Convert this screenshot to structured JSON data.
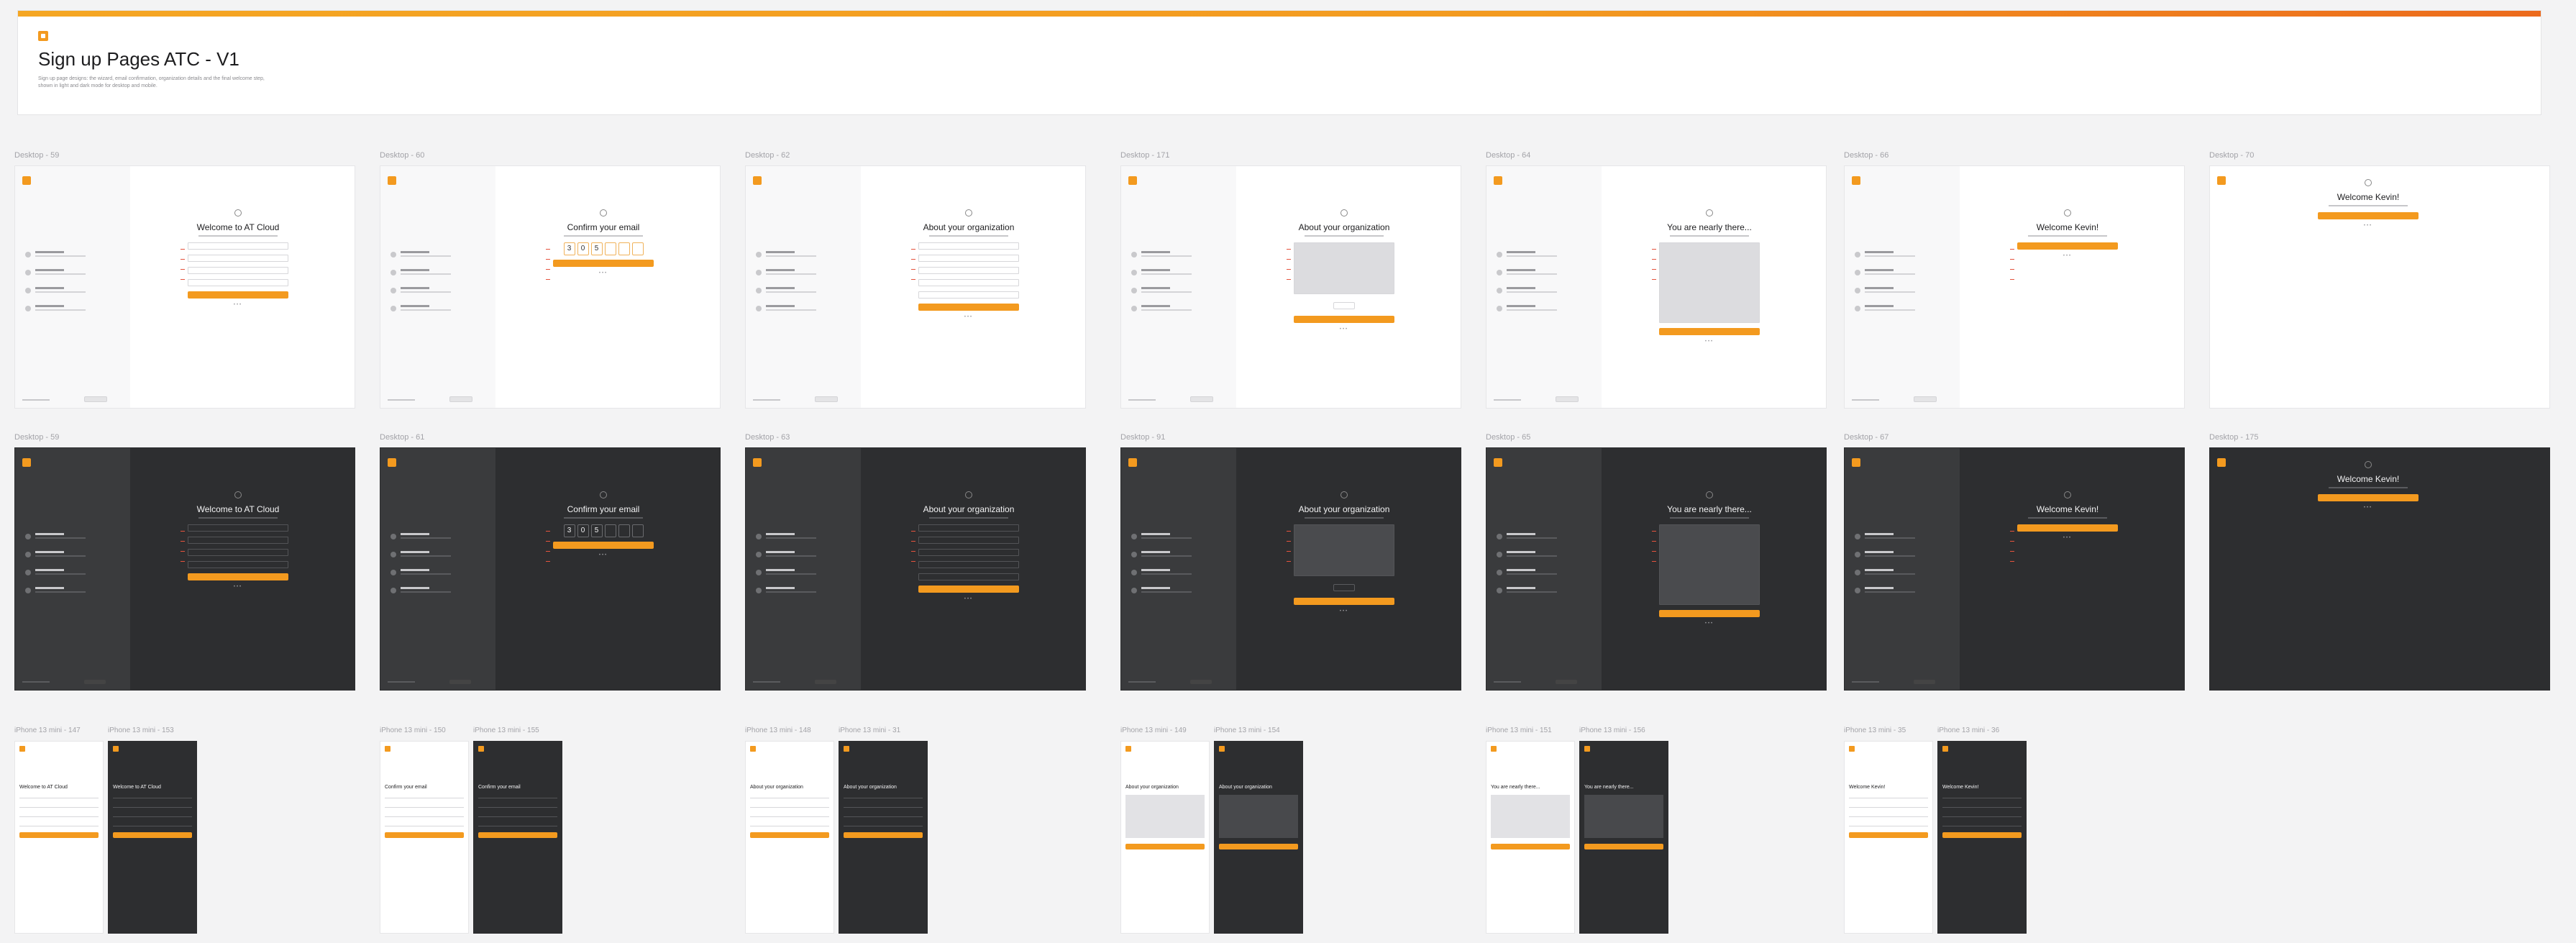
{
  "header": {
    "title": "Sign up Pages ATC - V1",
    "logo_text": "",
    "description": "Sign up page designs: the wizard, email confirmation, organization details and the final welcome step, shown in light and dark mode for desktop and mobile."
  },
  "colors": {
    "accent": "#f39a1f",
    "accent_end": "#ec6a1c",
    "dark_bg": "#2d2e30",
    "marker": "#e5533d"
  },
  "desktop_frames": [
    {
      "label": "Desktop - 59",
      "theme": "light",
      "kind": "welcome",
      "title": "Welcome to AT Cloud"
    },
    {
      "label": "Desktop - 60",
      "theme": "light",
      "kind": "confirm",
      "title": "Confirm your email",
      "code": [
        "3",
        "0",
        "5"
      ]
    },
    {
      "label": "Desktop - 62",
      "theme": "light",
      "kind": "org",
      "title": "About your organization"
    },
    {
      "label": "Desktop - 171",
      "theme": "light",
      "kind": "org-blur",
      "title": "About your organization"
    },
    {
      "label": "Desktop - 64",
      "theme": "light",
      "kind": "nearly",
      "title": "You are nearly there..."
    },
    {
      "label": "Desktop - 66",
      "theme": "light",
      "kind": "kevin",
      "title": "Welcome Kevin!"
    },
    {
      "label": "Desktop - 70",
      "theme": "light",
      "kind": "kevin-full",
      "title": "Welcome Kevin!"
    },
    {
      "label": "Desktop - 59",
      "theme": "dark",
      "kind": "welcome",
      "title": "Welcome to AT Cloud"
    },
    {
      "label": "Desktop - 61",
      "theme": "dark",
      "kind": "confirm",
      "title": "Confirm your email",
      "code": [
        "3",
        "0",
        "5"
      ]
    },
    {
      "label": "Desktop - 63",
      "theme": "dark",
      "kind": "org",
      "title": "About your organization"
    },
    {
      "label": "Desktop - 91",
      "theme": "dark",
      "kind": "org-blur",
      "title": "About your organization"
    },
    {
      "label": "Desktop - 65",
      "theme": "dark",
      "kind": "nearly",
      "title": "You are nearly there..."
    },
    {
      "label": "Desktop - 67",
      "theme": "dark",
      "kind": "kevin",
      "title": "Welcome Kevin!"
    },
    {
      "label": "Desktop - 175",
      "theme": "dark",
      "kind": "kevin-full",
      "title": "Welcome Kevin!"
    }
  ],
  "phone_frames": [
    {
      "label": "iPhone 13 mini - 147",
      "theme": "light",
      "title": "Welcome to AT Cloud"
    },
    {
      "label": "iPhone 13 mini - 153",
      "theme": "dark",
      "title": "Welcome to AT Cloud"
    },
    {
      "label": "iPhone 13 mini - 150",
      "theme": "light",
      "title": "Confirm your email"
    },
    {
      "label": "iPhone 13 mini - 155",
      "theme": "dark",
      "title": "Confirm your email"
    },
    {
      "label": "iPhone 13 mini - 148",
      "theme": "light",
      "title": "About your organization"
    },
    {
      "label": "iPhone 13 mini - 31",
      "theme": "dark",
      "title": "About your organization"
    },
    {
      "label": "iPhone 13 mini - 149",
      "theme": "light",
      "title": "About your organization"
    },
    {
      "label": "iPhone 13 mini - 154",
      "theme": "dark",
      "title": "About your organization"
    },
    {
      "label": "iPhone 13 mini - 151",
      "theme": "light",
      "title": "You are nearly there..."
    },
    {
      "label": "iPhone 13 mini - 156",
      "theme": "dark",
      "title": "You are nearly there..."
    },
    {
      "label": "iPhone 13 mini - 35",
      "theme": "light",
      "title": "Welcome Kevin!"
    },
    {
      "label": "iPhone 13 mini - 36",
      "theme": "dark",
      "title": "Welcome Kevin!"
    }
  ]
}
